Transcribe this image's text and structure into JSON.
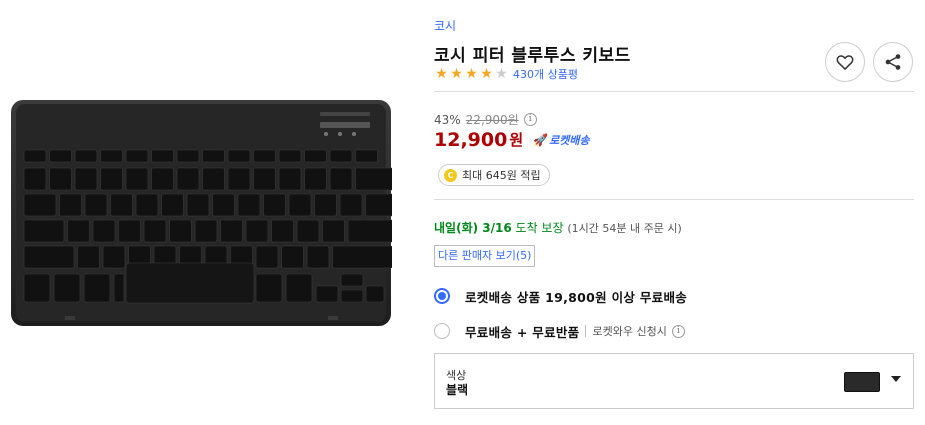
{
  "product": {
    "brand": "코시",
    "title": "코시 피터 블루투스 키보드",
    "rating_stars": 4,
    "rating_max": 5,
    "review_count": "430개 상품평"
  },
  "actions": {
    "wishlist_icon": "heart-icon",
    "share_icon": "share-icon"
  },
  "pricing": {
    "discount_rate": "43%",
    "original_price": "22,900원",
    "info_symbol": "i",
    "sale_price": "12,900",
    "currency": "원",
    "delivery_badge": "로켓배송",
    "cash_icon_letter": "C",
    "cash_reward": "최대 645원 적립"
  },
  "delivery": {
    "date": "내일(화) 3/16",
    "guarantee": "도착 보장",
    "cutoff": "(1시간 54분 내 주문 시)"
  },
  "seller_link": "다른 판매자 보기(5)",
  "shipping_options": [
    {
      "label": "로켓배송 상품 19,800원 이상 무료배송",
      "checked": true
    },
    {
      "label": "무료배송 + 무료반품",
      "note": "로켓와우 신청시",
      "checked": false
    }
  ],
  "option": {
    "label": "색상",
    "value": "블랙"
  },
  "colors": {
    "link_blue": "#346aff",
    "price_red": "#ae0000",
    "delivery_green": "#00891a",
    "star_orange": "#f5a623"
  }
}
